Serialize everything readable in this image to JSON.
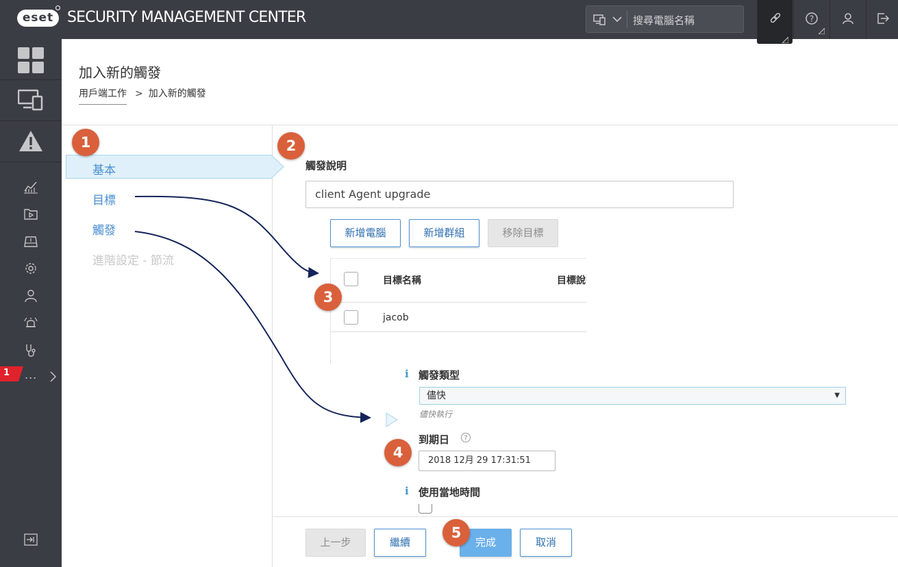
{
  "app": {
    "logo_text": "eset",
    "title": "SECURITY MANAGEMENT CENTER"
  },
  "search": {
    "placeholder": "搜尋電腦名稱"
  },
  "topbar_icons": [
    "link-icon",
    "help-icon",
    "user-icon",
    "logout-icon"
  ],
  "sidebar": {
    "items": [
      "dashboard-icon",
      "computers-icon",
      "alert-icon",
      "reports-icon",
      "tasks-icon",
      "installers-icon",
      "policies-icon",
      "users-icon",
      "notifications-icon",
      "status-overview-icon",
      "more-icon",
      "collapse-icon"
    ],
    "notification_count": "1",
    "more_label": "..."
  },
  "header": {
    "title": "加入新的觸發",
    "breadcrumb_parent": "用戶端工作",
    "breadcrumb_sep": ">",
    "breadcrumb_current": "加入新的觸發"
  },
  "steps": [
    {
      "label": "基本",
      "state": "active"
    },
    {
      "label": "目標",
      "state": "link"
    },
    {
      "label": "觸發",
      "state": "link"
    },
    {
      "label": "進階設定 - 節流",
      "state": "disabled"
    }
  ],
  "basic": {
    "description_label": "觸發說明",
    "description_value": "client Agent upgrade"
  },
  "target": {
    "add_computer": "新增電腦",
    "add_group": "新增群組",
    "remove_target": "移除目標",
    "columns": [
      "目標名稱",
      "目標說明"
    ],
    "rows": [
      {
        "name": "jacob"
      }
    ]
  },
  "trigger": {
    "type_label": "觸發類型",
    "type_value": "儘快",
    "type_hint": "儘快執行",
    "expiry_label": "到期日",
    "expiry_value": "2018 12月 29 17:31:51",
    "local_time_label": "使用當地時間"
  },
  "footer": {
    "back": "上一步",
    "continue": "繼續",
    "finish": "完成",
    "cancel": "取消"
  },
  "callouts": [
    "1",
    "2",
    "3",
    "4",
    "5"
  ],
  "colors": {
    "topbar": "#3b3d44",
    "accent_blue": "#4a8ed0",
    "callout": "#d9603b",
    "primary_button": "#6ab0ea",
    "arrow": "#14245a"
  }
}
